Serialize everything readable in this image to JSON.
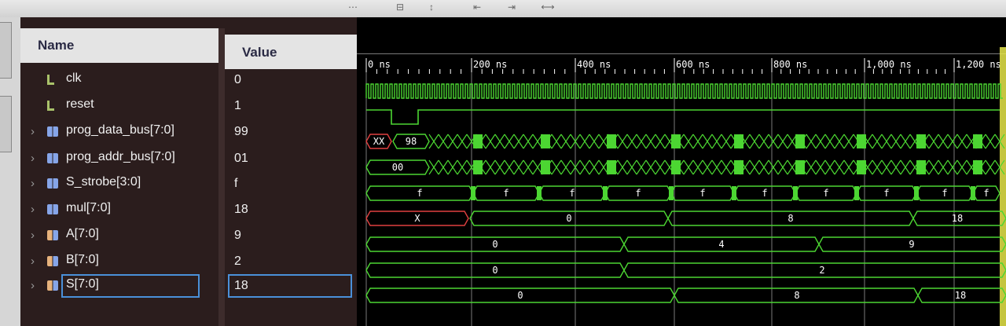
{
  "columns": {
    "name": "Name",
    "value": "Value"
  },
  "signals": [
    {
      "name": "clk",
      "value": "0",
      "kind": "single",
      "expandable": false
    },
    {
      "name": "reset",
      "value": "1",
      "kind": "single",
      "expandable": false
    },
    {
      "name": "prog_data_bus[7:0]",
      "value": "99",
      "kind": "bus",
      "expandable": true
    },
    {
      "name": "prog_addr_bus[7:0]",
      "value": "01",
      "kind": "bus",
      "expandable": true
    },
    {
      "name": "S_strobe[3:0]",
      "value": "f",
      "kind": "bus",
      "expandable": true
    },
    {
      "name": "mul[7:0]",
      "value": "18",
      "kind": "bus",
      "expandable": true
    },
    {
      "name": "A[7:0]",
      "value": "9",
      "kind": "bus2",
      "expandable": true
    },
    {
      "name": "B[7:0]",
      "value": "2",
      "kind": "bus2",
      "expandable": true
    },
    {
      "name": "S[7:0]",
      "value": "18",
      "kind": "bus2",
      "expandable": true,
      "selected": true
    }
  ],
  "timeline": {
    "ticks": [
      "0 ns",
      "200 ns",
      "400 ns",
      "600 ns",
      "800 ns",
      "1,000 ns",
      "1,200 ns"
    ]
  },
  "waveform_labels": {
    "prog_data_bus": [
      "XX",
      "98"
    ],
    "prog_addr_bus": [
      "00"
    ],
    "S_strobe": [
      "f",
      "f",
      "f",
      "f",
      "f",
      "f",
      "f",
      "f",
      "f",
      "f",
      "f"
    ],
    "mul": [
      "X",
      "0",
      "8",
      "18"
    ],
    "A": [
      "0",
      "4",
      "9"
    ],
    "B": [
      "0",
      "2"
    ],
    "S": [
      "0",
      "8",
      "18"
    ]
  },
  "colors": {
    "wave": "#4cd632",
    "undefined": "#e04040",
    "selection": "#4a90d9"
  }
}
